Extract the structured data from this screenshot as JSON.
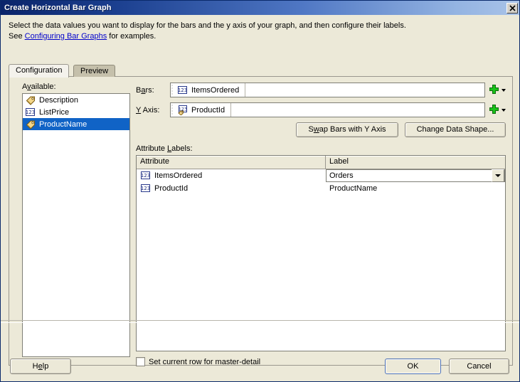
{
  "window": {
    "title": "Create Horizontal Bar Graph",
    "close_label": "✕",
    "close_icon": "close-icon"
  },
  "intro": {
    "line1_before": "Select the data values you want to display for the bars and the y axis of your graph, and then configure their labels.",
    "line2_before": "See ",
    "link_text": "Configuring Bar Graphs",
    "line2_after": " for examples."
  },
  "tabs": [
    {
      "label": "Configuration",
      "active": true
    },
    {
      "label": "Preview",
      "active": false
    }
  ],
  "available": {
    "label_pre": "A",
    "label_acc": "v",
    "label_post": "ailable:",
    "items": [
      {
        "label": "Description",
        "icon": "attribute-tag-icon",
        "selected": false
      },
      {
        "label": "ListPrice",
        "icon": "numeric-123-icon",
        "selected": false
      },
      {
        "label": "ProductName",
        "icon": "attribute-tag-icon",
        "selected": true
      }
    ]
  },
  "fields": {
    "bars": {
      "label_pre": "B",
      "label_acc": "a",
      "label_post": "rs:",
      "value": "ItemsOrdered",
      "icon": "numeric-123-icon",
      "add_icon": "green-plus-icon"
    },
    "yaxis": {
      "label_pre": "",
      "label_acc": "Y",
      "label_post": " Axis:",
      "value": "ProductId",
      "icon": "numeric-key-icon",
      "add_icon": "green-plus-icon"
    }
  },
  "buttons": {
    "swap_pre": "S",
    "swap_acc": "w",
    "swap_post": "ap Bars with Y Axis",
    "shape_pre": "Chan",
    "shape_acc": "g",
    "shape_post": "e Data Shape..."
  },
  "attribute_labels": {
    "caption_pre": "Attribute ",
    "caption_acc": "L",
    "caption_post": "abels:",
    "columns": [
      "Attribute",
      "Label"
    ],
    "rows": [
      {
        "attribute": "ItemsOrdered",
        "icon": "numeric-123-icon",
        "label": "Orders",
        "editing": true
      },
      {
        "attribute": "ProductId",
        "icon": "numeric-123-icon",
        "label": "ProductName",
        "editing": false
      }
    ]
  },
  "master_detail": {
    "label": "Set current row for master-detail",
    "checked": false
  },
  "footer": {
    "help_pre": "H",
    "help_acc": "e",
    "help_post": "lp",
    "ok": "OK",
    "cancel": "Cancel"
  },
  "colors": {
    "title_start": "#0a246a",
    "title_end": "#a9c3e8",
    "selection": "#1063c6",
    "link": "#0000cc",
    "face": "#ece9d8",
    "plus_green": "#00a000"
  }
}
